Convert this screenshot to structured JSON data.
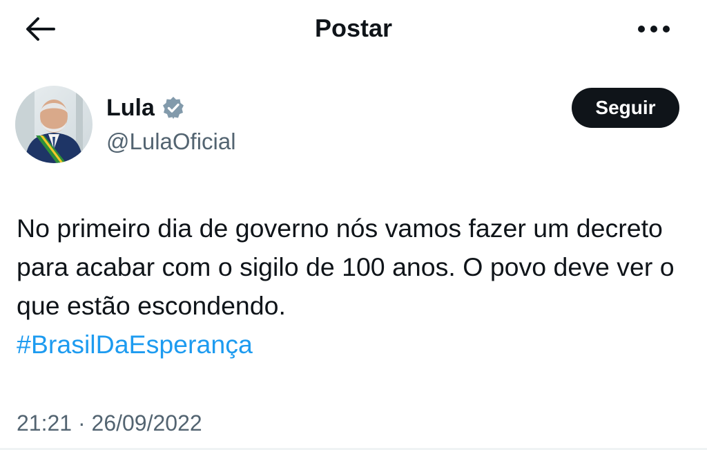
{
  "header": {
    "title": "Postar",
    "back_icon": "arrow-left-icon",
    "more_icon": "more-horizontal-icon"
  },
  "author": {
    "name": "Lula",
    "handle": "@LulaOficial",
    "verified_icon": "verified-badge-icon",
    "follow_label": "Seguir"
  },
  "post": {
    "text": "No primeiro dia de governo nós vamos fazer um decreto para acabar com o sigilo de 100 anos. O povo deve ver o que estão escondendo.",
    "hashtag": "#BrasilDaEsperança",
    "time": "21:21",
    "separator": "·",
    "date": "26/09/2022"
  },
  "colors": {
    "text": "#0f1419",
    "secondary_text": "#536471",
    "link": "#1d9bf0",
    "follow_bg": "#0f1419",
    "verified": "#829aab"
  }
}
